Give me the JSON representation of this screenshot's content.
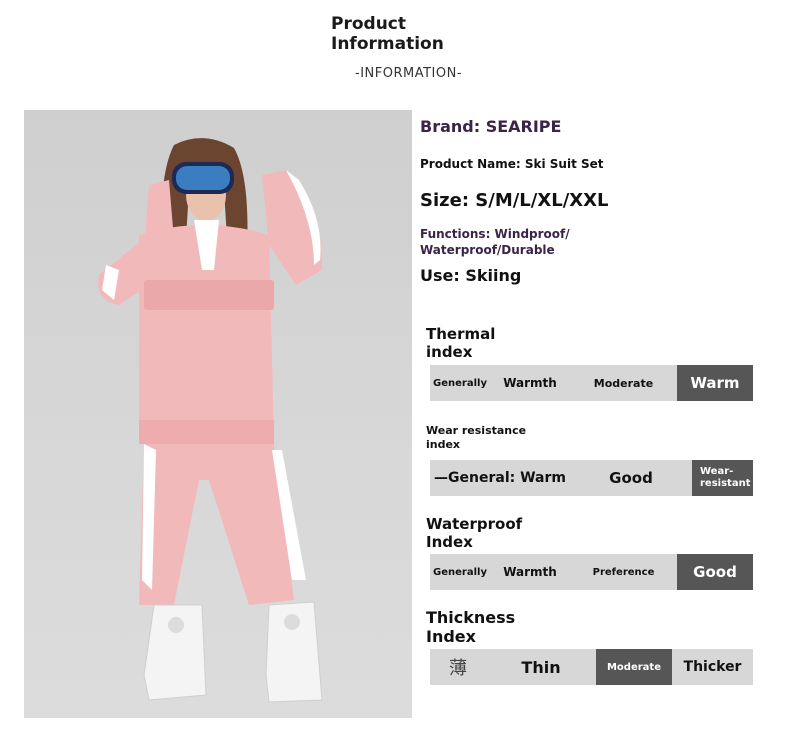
{
  "header": {
    "title": "Product Information",
    "subtitle": "-INFORMATION-"
  },
  "product": {
    "brand": "Brand: SEARIPE",
    "name": "Product Name: Ski Suit Set",
    "size": "Size: S/M/L/XL/XXL",
    "functions": "Functions: Windproof/ Waterproof/Durable",
    "use": "Use: Skiing"
  },
  "indices": {
    "thermal": {
      "title": "Thermal index",
      "options": [
        "Generally",
        "Warmth",
        "Moderate",
        "Warm"
      ],
      "active": "Warm"
    },
    "wear": {
      "title": "Wear resistance index",
      "options": [
        "—General: Warm",
        "Good",
        "Wear-resistant"
      ],
      "active": "Wear-resistant"
    },
    "waterproof": {
      "title": "Waterproof Index",
      "options": [
        "Generally",
        "Warmth",
        "Preference",
        "Good"
      ],
      "active": "Good"
    },
    "thickness": {
      "title": "Thickness Index",
      "options": [
        "薄",
        "Thin",
        "Moderate",
        "Thicker"
      ],
      "active": "Moderate"
    }
  },
  "colors": {
    "accent_text": "#3a2448",
    "bar_bg": "#d7d7d7",
    "bar_active": "#565656",
    "suit_pink": "#f2b9bb"
  }
}
